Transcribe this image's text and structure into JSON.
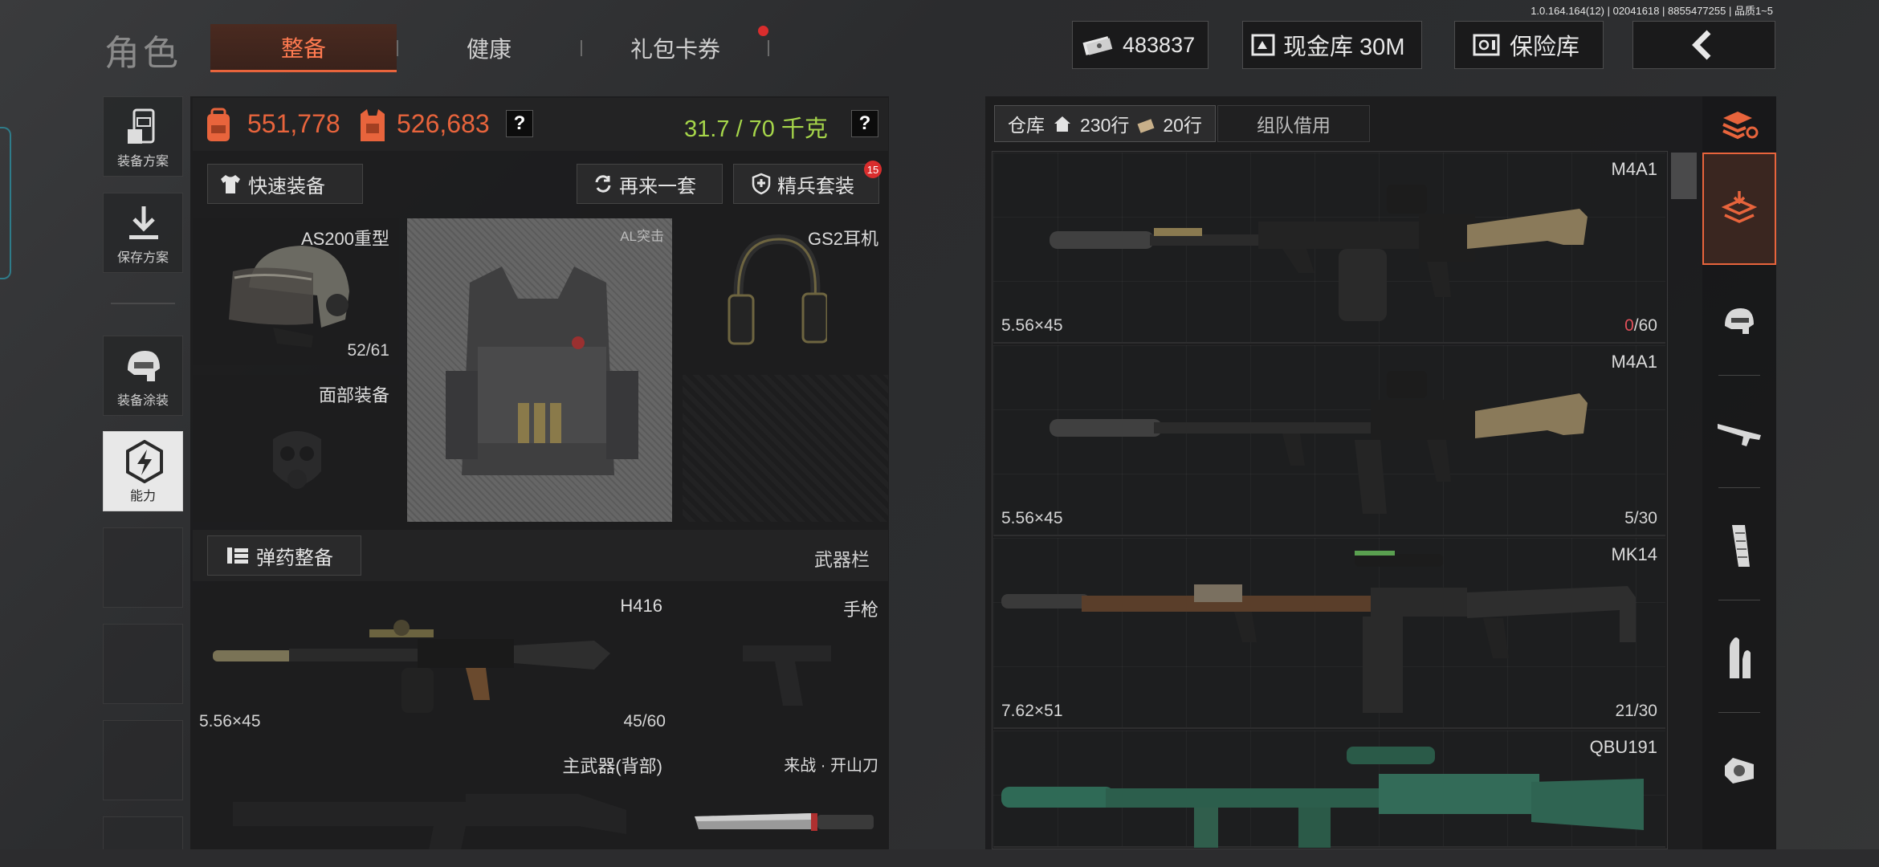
{
  "version": "1.0.164.164(12) | 02041618 | 8855477255 | 品质1~5",
  "header": {
    "title": "角色",
    "tabs": [
      {
        "label": "整备",
        "active": true
      },
      {
        "label": "健康",
        "active": false
      },
      {
        "label": "礼包卡券",
        "active": false,
        "badge_dot": true
      }
    ],
    "currency": "483837",
    "cash_store": "现金库 30M",
    "safe": "保险库"
  },
  "sidebar": {
    "items": [
      {
        "label": "装备方案",
        "icon": "backpack-vest-icon"
      },
      {
        "label": "保存方案",
        "icon": "download-icon"
      },
      {
        "label": "装备涂装",
        "icon": "helmet-icon"
      },
      {
        "label": "能力",
        "icon": "lightning-hex-icon"
      }
    ]
  },
  "stats": {
    "backpack_value": "551,778",
    "vest_value": "526,683",
    "weight": "31.7 / 70 千克",
    "help": "?"
  },
  "actions": {
    "quick_equip": "快速装备",
    "again": "再来一套",
    "elite": "精兵套装",
    "elite_badge": "15"
  },
  "gear": {
    "helmet": {
      "name": "AS200重型",
      "durability": "52/61"
    },
    "armor": {
      "name": "AL突击"
    },
    "headset": {
      "name": "GS2耳机"
    },
    "face": {
      "name": "面部装备"
    }
  },
  "weapons_bar": {
    "ammo_button": "弹药整备",
    "label": "武器栏",
    "primary": {
      "name": "H416",
      "caliber": "5.56×45",
      "ammo": "45/60"
    },
    "pistol": {
      "name": "手枪"
    },
    "back": {
      "name": "主武器(背部)"
    },
    "melee": {
      "name": "来战 · 开山刀"
    }
  },
  "warehouse": {
    "tab_label": "仓库",
    "rows": "230行",
    "rows2": "20行",
    "team_tab": "组队借用",
    "items": [
      {
        "name": "M4A1",
        "caliber": "5.56×45",
        "ammo_current": "0",
        "ammo_max": "/60",
        "ammo_current_color": "#e0505a"
      },
      {
        "name": "M4A1",
        "caliber": "5.56×45",
        "ammo_current": "5",
        "ammo_max": "/30",
        "ammo_current_color": "#d4d4d4"
      },
      {
        "name": "MK14",
        "caliber": "7.62×51",
        "ammo_current": "21",
        "ammo_max": "/30",
        "ammo_current_color": "#d4d4d4"
      },
      {
        "name": "QBU191",
        "caliber": "",
        "ammo_current": "",
        "ammo_max": "",
        "ammo_current_color": "#d4d4d4"
      }
    ]
  },
  "right_tabs": [
    {
      "icon": "refresh-layers-icon",
      "active": false
    },
    {
      "icon": "layers-download-icon",
      "active": true
    },
    {
      "icon": "helmet-icon",
      "active": false
    },
    {
      "icon": "rifle-icon",
      "active": false
    },
    {
      "icon": "magazine-icon",
      "active": false
    },
    {
      "icon": "bullets-icon",
      "active": false
    },
    {
      "icon": "scope-icon",
      "active": false
    }
  ],
  "colors": {
    "accent_orange": "#e8643c",
    "weight_green": "#a6d64a",
    "badge_red": "#d92d2d"
  }
}
